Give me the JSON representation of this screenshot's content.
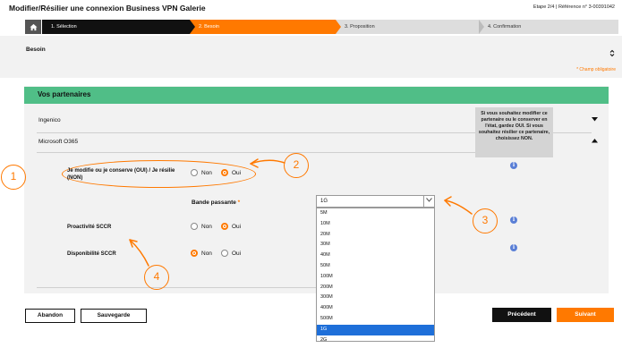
{
  "header": {
    "title": "Modifier/Résilier une connexion Business VPN Galerie",
    "step_info": "Etape 2/4 | Référence n° 3-00391042"
  },
  "stepper": {
    "home_icon": "home-icon",
    "steps": [
      {
        "label": "1. Sélection",
        "state": "done"
      },
      {
        "label": "2. Besoin",
        "state": "current"
      },
      {
        "label": "3. Proposition",
        "state": "todo"
      },
      {
        "label": "4. Confirmation",
        "state": "todo"
      }
    ]
  },
  "besoin": {
    "title": "Besoin",
    "mandatory_note": "* Champ obligatoire"
  },
  "partners": {
    "title": "Vos partenaires",
    "items": [
      {
        "name": "Ingenico",
        "expanded": false
      },
      {
        "name": "Microsoft O365",
        "expanded": true
      }
    ],
    "tooltip": "Si vous souhaitez modifier ce partenaire ou le conserver en l'état, gardez OUI. Si vous souhaitez résilier ce partenaire, choisissez NON."
  },
  "form": {
    "q1_label": "Je modifie ou je conserve (OUI) / Je résilie (NON)",
    "q1_options": [
      "Non",
      "Oui"
    ],
    "q1_selected": "Oui",
    "bandwidth_label": "Bande passante",
    "bandwidth_required": "*",
    "bandwidth_value": "1G",
    "bandwidth_options": [
      "5M",
      "10M",
      "20M",
      "30M",
      "40M",
      "50M",
      "100M",
      "200M",
      "300M",
      "400M",
      "500M",
      "1G",
      "2G"
    ],
    "proactivite_label": "Proactivité SCCR",
    "proactivite_options": [
      "Non",
      "Oui"
    ],
    "proactivite_selected": "Oui",
    "disponibilite_label": "Disponibilité SCCR",
    "disponibilite_options": [
      "Non",
      "Oui"
    ],
    "disponibilite_selected": "Non"
  },
  "annotations": [
    "1",
    "2",
    "3",
    "4"
  ],
  "buttons": {
    "abandon": "Abandon",
    "sauvegarde": "Sauvegarde",
    "precedent": "Précédent",
    "suivant": "Suivant"
  },
  "colors": {
    "accent": "#ff7900",
    "partner_header": "#50be87",
    "info": "#5a7fd6",
    "selected_option": "#1e6fd9"
  }
}
